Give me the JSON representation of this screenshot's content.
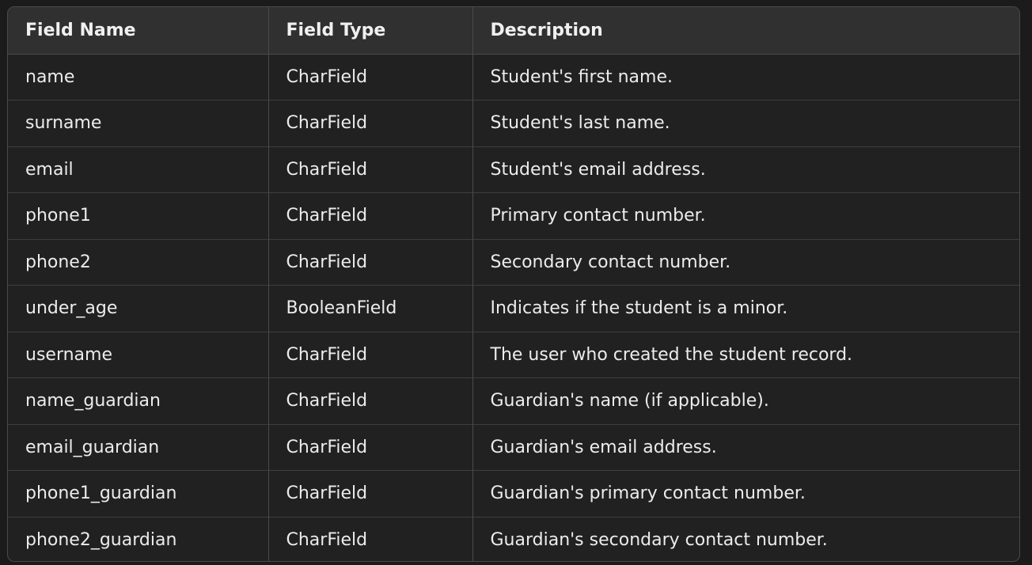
{
  "table": {
    "headers": [
      "Field Name",
      "Field Type",
      "Description"
    ],
    "rows": [
      [
        "name",
        "CharField",
        "Student's first name."
      ],
      [
        "surname",
        "CharField",
        "Student's last name."
      ],
      [
        "email",
        "CharField",
        "Student's email address."
      ],
      [
        "phone1",
        "CharField",
        "Primary contact number."
      ],
      [
        "phone2",
        "CharField",
        "Secondary contact number."
      ],
      [
        "under_age",
        "BooleanField",
        "Indicates if the student is a minor."
      ],
      [
        "username",
        "CharField",
        "The user who created the student record."
      ],
      [
        "name_guardian",
        "CharField",
        "Guardian's name (if applicable)."
      ],
      [
        "email_guardian",
        "CharField",
        "Guardian's email address."
      ],
      [
        "phone1_guardian",
        "CharField",
        "Guardian's primary contact number."
      ],
      [
        "phone2_guardian",
        "CharField",
        "Guardian's secondary contact number."
      ]
    ]
  },
  "colors": {
    "background": "#212121",
    "header_background": "#303030",
    "border": "#4a4a4a",
    "text": "#ececec"
  }
}
